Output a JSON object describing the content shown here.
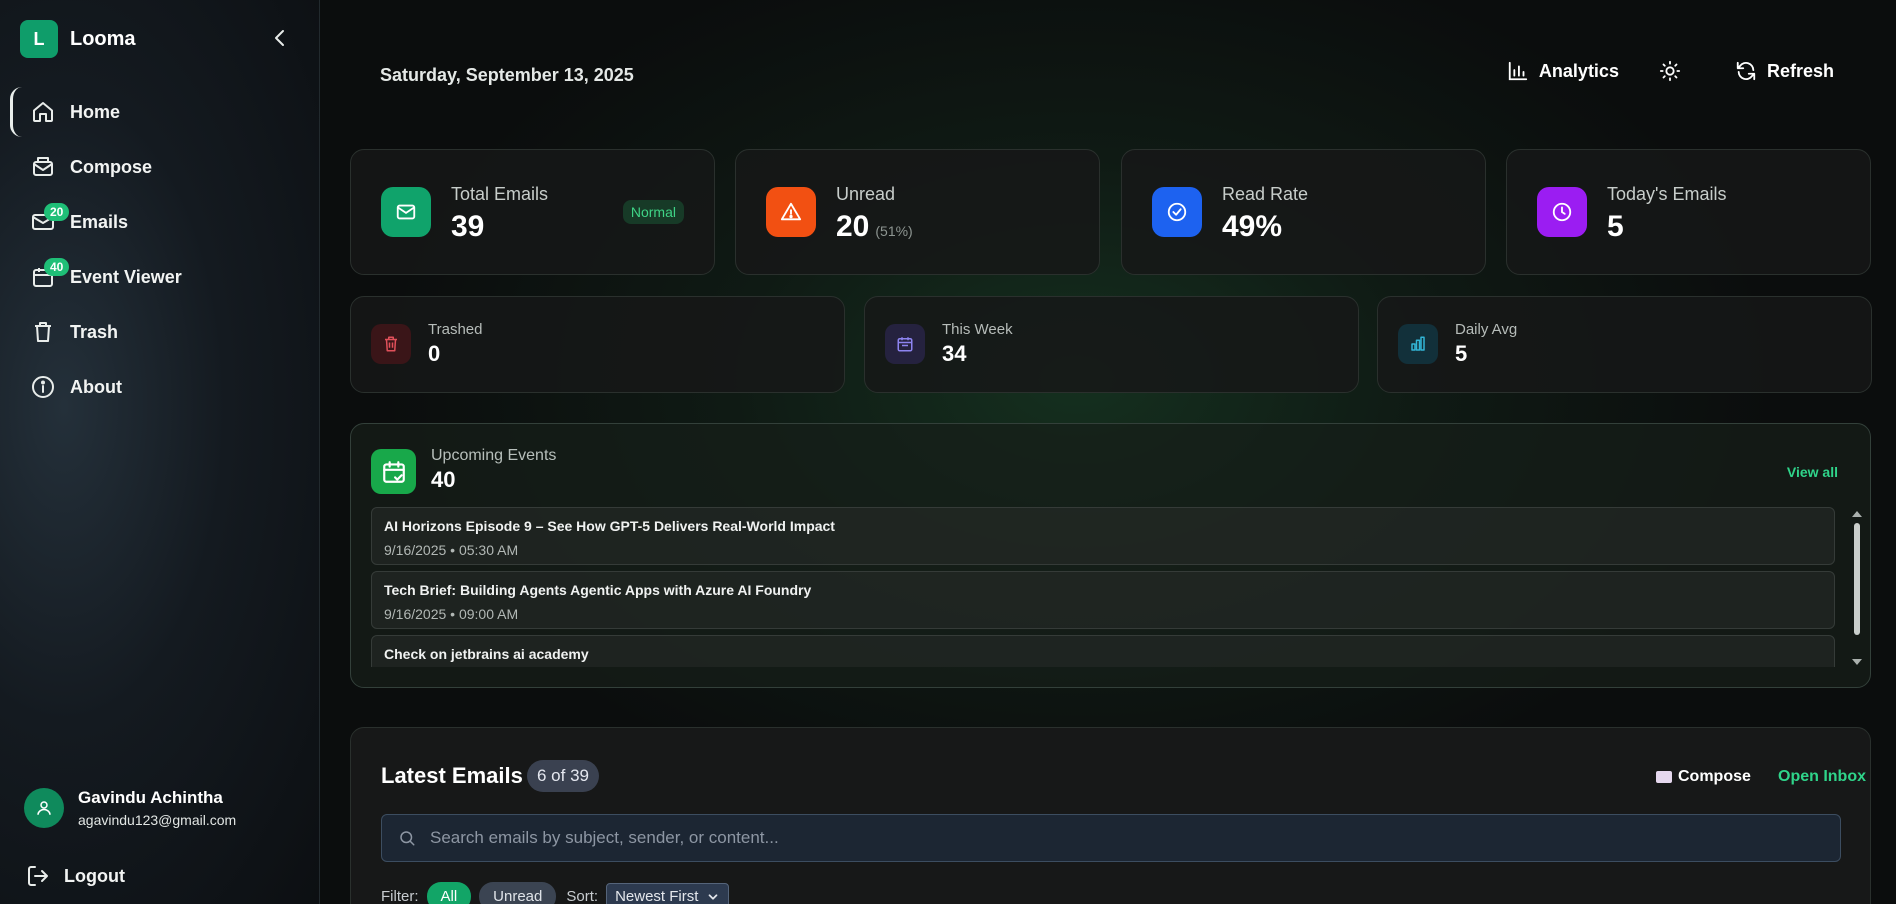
{
  "brand": {
    "initial": "L",
    "name": "Looma"
  },
  "nav": {
    "items": [
      {
        "label": "Home",
        "icon": "home-icon",
        "active": true
      },
      {
        "label": "Compose",
        "icon": "compose-icon"
      },
      {
        "label": "Emails",
        "icon": "mail-icon",
        "badge": "20"
      },
      {
        "label": "Event Viewer",
        "icon": "calendar-icon",
        "badge": "40"
      },
      {
        "label": "Trash",
        "icon": "trash-icon"
      },
      {
        "label": "About",
        "icon": "info-icon"
      }
    ]
  },
  "user": {
    "name": "Gavindu Achintha",
    "email": "agavindu123@gmail.com"
  },
  "logout_label": "Logout",
  "header": {
    "date": "Saturday, September 13, 2025",
    "analytics_label": "Analytics",
    "refresh_label": "Refresh"
  },
  "stats": [
    {
      "label": "Total Emails",
      "value": "39",
      "pill": "Normal",
      "color": "#10a36b"
    },
    {
      "label": "Unread",
      "value": "20",
      "sub": "(51%)",
      "color": "#f25012"
    },
    {
      "label": "Read Rate",
      "value": "49%",
      "color": "#1d62f0"
    },
    {
      "label": "Today's Emails",
      "value": "5",
      "color": "#9b1df2"
    }
  ],
  "mini_stats": [
    {
      "label": "Trashed",
      "value": "0",
      "color": "#3a1518"
    },
    {
      "label": "This Week",
      "value": "34",
      "color": "#25223f"
    },
    {
      "label": "Daily Avg",
      "value": "5",
      "color": "#12303a"
    }
  ],
  "events": {
    "label": "Upcoming Events",
    "count": "40",
    "view_all": "View all",
    "items": [
      {
        "title": "AI Horizons Episode 9 – See How GPT-5 Delivers Real-World Impact",
        "time": "9/16/2025 • 05:30 AM"
      },
      {
        "title": "Tech Brief: Building Agents Agentic Apps with Azure AI Foundry",
        "time": "9/16/2025 • 09:00 AM"
      },
      {
        "title": "Check on jetbrains ai academy",
        "time": ""
      }
    ]
  },
  "latest": {
    "title": "Latest Emails",
    "count": "6 of 39",
    "compose_label": "Compose",
    "open_inbox_label": "Open Inbox",
    "search_placeholder": "Search emails by subject, sender, or content...",
    "filter_label": "Filter:",
    "filters": [
      "All",
      "Unread"
    ],
    "sort_label": "Sort:",
    "sort_value": "Newest First"
  }
}
